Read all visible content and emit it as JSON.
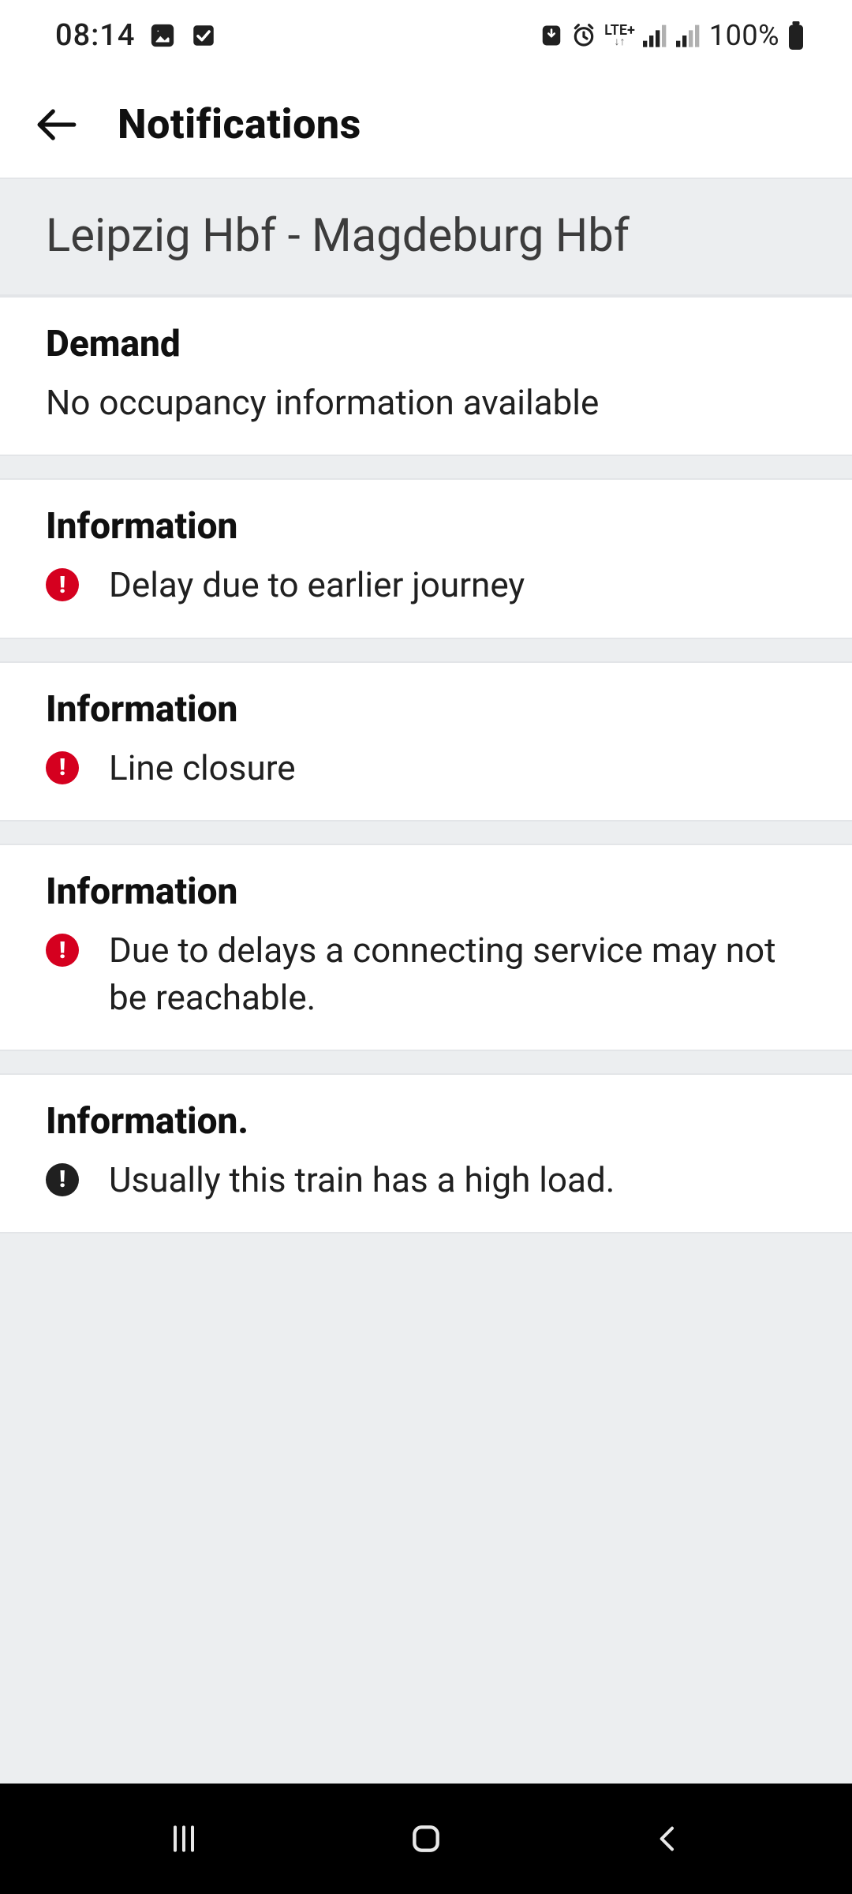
{
  "status": {
    "time": "08:14",
    "net_label": "LTE+",
    "battery": "100%"
  },
  "header": {
    "title": "Notifications"
  },
  "route": {
    "label": "Leipzig Hbf - Magdeburg Hbf"
  },
  "cards": [
    {
      "title": "Demand",
      "body": "No occupancy information available",
      "icon": null
    },
    {
      "title": "Information",
      "body": "Delay due to earlier journey",
      "icon": "red"
    },
    {
      "title": "Information",
      "body": "Line closure",
      "icon": "red"
    },
    {
      "title": "Information",
      "body": "Due to delays a connecting service may not be reachable.",
      "icon": "red"
    },
    {
      "title": "Information.",
      "body": "Usually this train has a high load.",
      "icon": "black"
    }
  ],
  "colors": {
    "alert_red": "#d5001f",
    "bg_grey": "#eceef0"
  }
}
